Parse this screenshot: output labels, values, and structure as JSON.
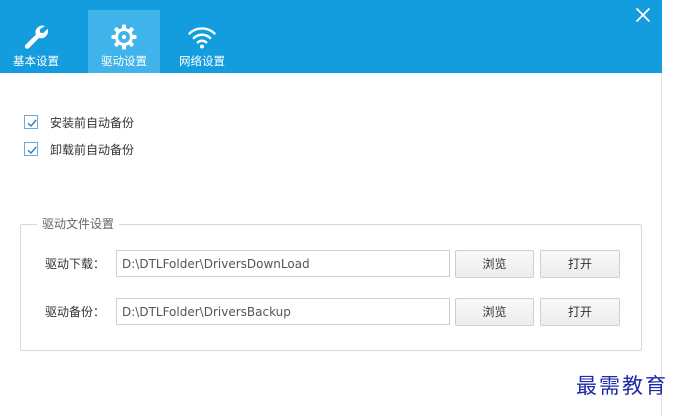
{
  "header": {
    "tabs": [
      {
        "label": "基本设置",
        "icon": "wrench-icon",
        "active": false
      },
      {
        "label": "驱动设置",
        "icon": "gear-icon",
        "active": true
      },
      {
        "label": "网络设置",
        "icon": "wifi-icon",
        "active": false
      }
    ],
    "close_icon": "close-icon",
    "accent_color": "#139ddf",
    "active_tab_color": "#3fb3ea"
  },
  "options": {
    "backup_before_install": {
      "label": "安装前自动备份",
      "checked": true
    },
    "backup_before_uninstall": {
      "label": "卸载前自动备份",
      "checked": true
    }
  },
  "driver_files": {
    "title": "驱动文件设置",
    "download": {
      "label": "驱动下载：",
      "path": "D:\\DTLFolder\\DriversDownLoad",
      "browse_label": "浏览",
      "open_label": "打开"
    },
    "backup": {
      "label": "驱动备份：",
      "path": "D:\\DTLFolder\\DriversBackup",
      "browse_label": "浏览",
      "open_label": "打开"
    }
  },
  "watermark": "最需教育"
}
